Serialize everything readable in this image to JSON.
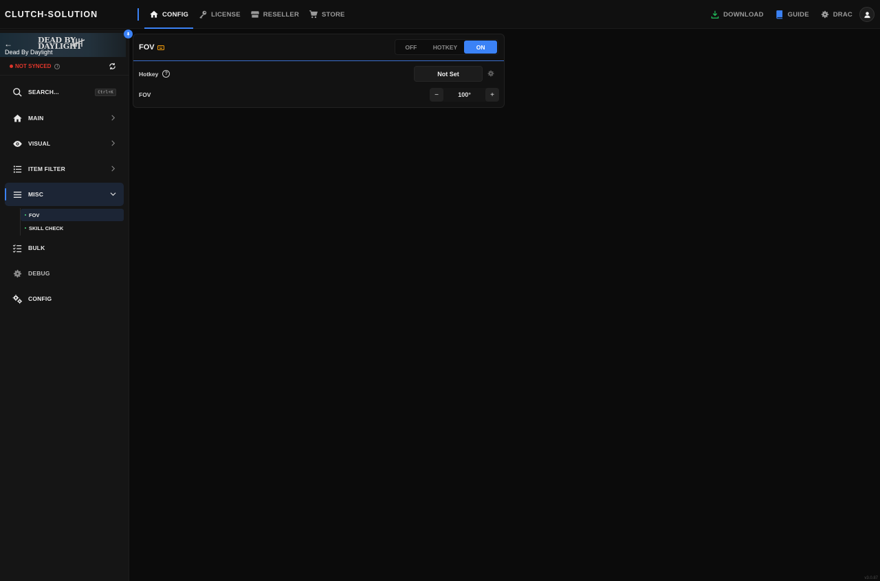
{
  "brand": "CLUTCH-SOLUTION",
  "topnav": [
    {
      "label": "CONFIG",
      "icon": "home-icon",
      "active": true
    },
    {
      "label": "LICENSE",
      "icon": "key-icon",
      "active": false
    },
    {
      "label": "RESELLER",
      "icon": "storefront-icon",
      "active": false
    },
    {
      "label": "STORE",
      "icon": "cart-icon",
      "active": false
    }
  ],
  "right_nav": {
    "download": "DOWNLOAD",
    "guide": "GUIDE",
    "user": "DRAC"
  },
  "game": {
    "name": "Dead By Daylight",
    "logo_line1": "DEAD BY",
    "logo_line2": "DAYLIGHT",
    "back_arrow": "←"
  },
  "sync": {
    "status": "NOT SYNCED",
    "info": "i",
    "color": "#e0362b"
  },
  "sidebar": {
    "search_label": "SEARCH...",
    "search_shortcut": "Ctrl+K",
    "items": [
      {
        "label": "MAIN",
        "icon": "home-icon"
      },
      {
        "label": "VISUAL",
        "icon": "eye-icon"
      },
      {
        "label": "ITEM FILTER",
        "icon": "list-icon"
      },
      {
        "label": "MISC",
        "icon": "menu-icon"
      },
      {
        "label": "BULK",
        "icon": "checklist-icon"
      },
      {
        "label": "DEBUG",
        "icon": "gear-icon"
      },
      {
        "label": "CONFIG",
        "icon": "gears-icon"
      }
    ],
    "misc_sub": [
      {
        "label": "FOV",
        "active": true
      },
      {
        "label": "SKILL CHECK",
        "active": false
      }
    ]
  },
  "panel": {
    "title": "FOV",
    "modes": [
      "OFF",
      "HOTKEY",
      "ON"
    ],
    "active_mode": "ON",
    "hotkey_label": "Hotkey",
    "help": "?",
    "hotkey_value": "Not Set",
    "fov_label": "FOV",
    "fov_value": "100°",
    "minus": "−",
    "plus": "+"
  },
  "version": "v3.0.87",
  "colors": {
    "accent": "#3b82f6",
    "download_icon": "#22c55e",
    "guide_icon": "#3b82f6",
    "keyboard_icon": "#f59e0b"
  }
}
